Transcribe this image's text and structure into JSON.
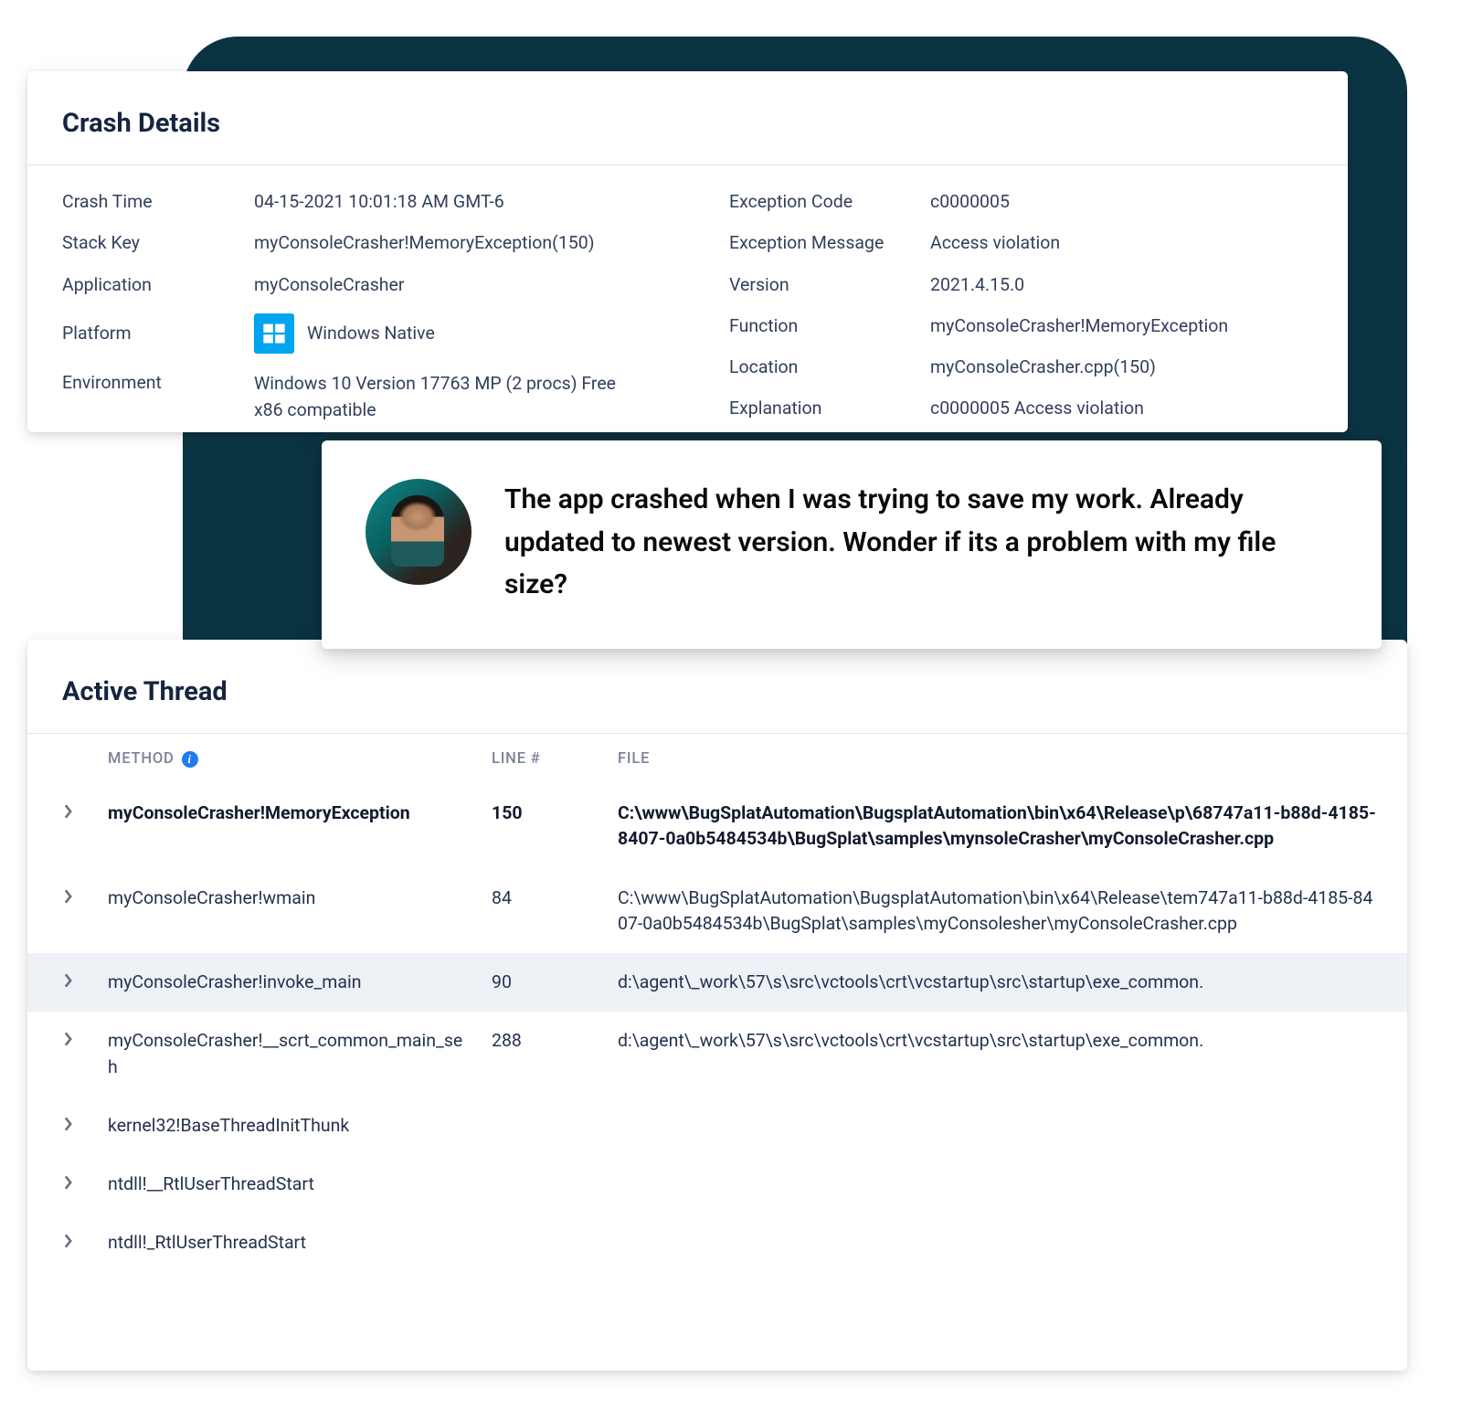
{
  "crashDetails": {
    "title": "Crash Details",
    "left": {
      "crashTime": {
        "label": "Crash Time",
        "value": "04-15-2021 10:01:18 AM GMT-6"
      },
      "stackKey": {
        "label": "Stack Key",
        "value": "myConsoleCrasher!MemoryException(150)"
      },
      "application": {
        "label": "Application",
        "value": "myConsoleCrasher"
      },
      "platform": {
        "label": "Platform",
        "value": "Windows Native",
        "icon": "windows-icon"
      },
      "environment": {
        "label": "Environment",
        "value": "Windows 10 Version 17763 MP (2 procs) Free x86 compatible"
      }
    },
    "right": {
      "exceptionCode": {
        "label": "Exception Code",
        "value": "c0000005"
      },
      "exceptionMessage": {
        "label": "Exception Message",
        "value": "Access violation"
      },
      "version": {
        "label": "Version",
        "value": "2021.4.15.0"
      },
      "function": {
        "label": "Function",
        "value": "myConsoleCrasher!MemoryException"
      },
      "location": {
        "label": "Location",
        "value": "myConsoleCrasher.cpp(150)"
      },
      "explanation": {
        "label": "Explanation",
        "value": "c0000005 Access violation"
      }
    }
  },
  "comment": {
    "text": "The app crashed when I was trying to save my work. Already updated to newest version. Wonder if its a problem with my file size?"
  },
  "activeThread": {
    "title": "Active Thread",
    "headers": {
      "method": "METHOD",
      "line": "LINE #",
      "file": "FILE"
    },
    "rows": [
      {
        "method": "myConsoleCrasher!MemoryException",
        "line": "150",
        "file": "C:\\www\\BugSplatAutomation\\BugsplatAutomation\\bin\\x64\\Release\\p\\68747a11-b88d-4185-8407-0a0b5484534b\\BugSplat\\samples\\mynsoleCrasher\\myConsoleCrasher.cpp",
        "bold": true
      },
      {
        "method": "myConsoleCrasher!wmain",
        "line": "84",
        "file": "C:\\www\\BugSplatAutomation\\BugsplatAutomation\\bin\\x64\\Release\\tem747a11-b88d-4185-8407-0a0b5484534b\\BugSplat\\samples\\myConsolesher\\myConsoleCrasher.cpp"
      },
      {
        "method": "myConsoleCrasher!invoke_main",
        "line": "90",
        "file": "d:\\agent\\_work\\57\\s\\src\\vctools\\crt\\vcstartup\\src\\startup\\exe_common.",
        "highlight": true
      },
      {
        "method": "myConsoleCrasher!__scrt_common_main_seh",
        "line": "288",
        "file": "d:\\agent\\_work\\57\\s\\src\\vctools\\crt\\vcstartup\\src\\startup\\exe_common."
      },
      {
        "method": "kernel32!BaseThreadInitThunk",
        "line": "",
        "file": ""
      },
      {
        "method": "ntdll!__RtlUserThreadStart",
        "line": "",
        "file": ""
      },
      {
        "method": "ntdll!_RtlUserThreadStart",
        "line": "",
        "file": ""
      }
    ]
  }
}
